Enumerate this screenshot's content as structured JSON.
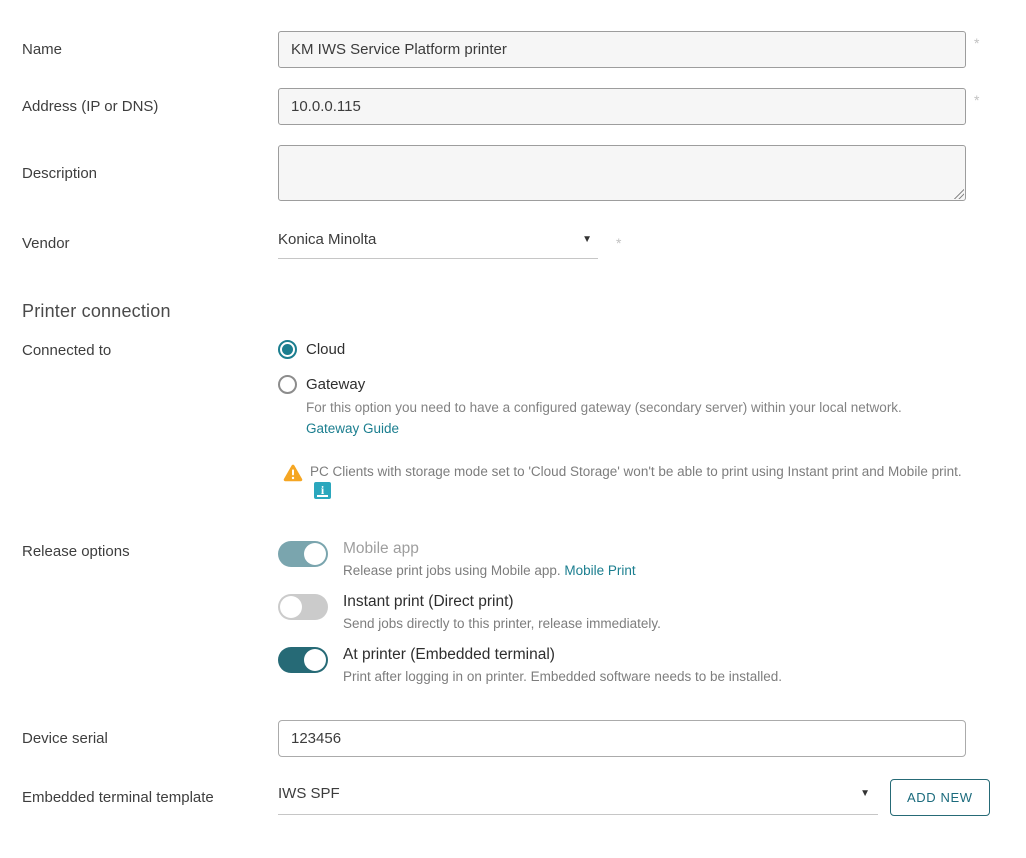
{
  "colors": {
    "accent_teal": "#1b7e8f",
    "toggle_on": "#266a76",
    "toggle_muted": "#7aa5ae",
    "toggle_off": "#cbcbcb",
    "warning_orange": "#f5a623",
    "info_icon_teal": "#2ba7bd",
    "input_bg": "#f6f6f6"
  },
  "fields": {
    "name": {
      "label": "Name",
      "value": "KM IWS Service Platform printer",
      "required_marker": "*"
    },
    "address": {
      "label": "Address (IP or DNS)",
      "value": "10.0.0.115",
      "required_marker": "*"
    },
    "description": {
      "label": "Description",
      "value": ""
    },
    "vendor": {
      "label": "Vendor",
      "value": "Konica Minolta",
      "required_marker": "*",
      "chevron": "▼"
    }
  },
  "printer_connection": {
    "title": "Printer connection",
    "connected_to_label": "Connected to",
    "options": [
      {
        "label": "Cloud",
        "selected": true
      },
      {
        "label": "Gateway",
        "selected": false
      }
    ],
    "gateway_description": "For this option you need to have a configured gateway (secondary server) within your local network.",
    "gateway_link": "Gateway Guide",
    "warning_text": "PC Clients with storage mode set to 'Cloud Storage' won't be able to print using Instant print and Mobile print.",
    "warning_icon": "warning-triangle",
    "info_icon": "manual-info"
  },
  "release_options": {
    "label": "Release options",
    "toggles": [
      {
        "label": "Mobile app",
        "state": "on-muted",
        "description": "Release print jobs using Mobile app.",
        "link": "Mobile Print"
      },
      {
        "label": "Instant print (Direct print)",
        "state": "off",
        "description": "Send jobs directly to this printer, release immediately."
      },
      {
        "label": "At printer (Embedded terminal)",
        "state": "on",
        "description": "Print after logging in on printer. Embedded software needs to be installed."
      }
    ]
  },
  "device_serial": {
    "label": "Device serial",
    "value": "123456"
  },
  "embedded_terminal_template": {
    "label": "Embedded terminal template",
    "value": "IWS SPF",
    "chevron": "▼",
    "add_button_label": "ADD NEW"
  }
}
